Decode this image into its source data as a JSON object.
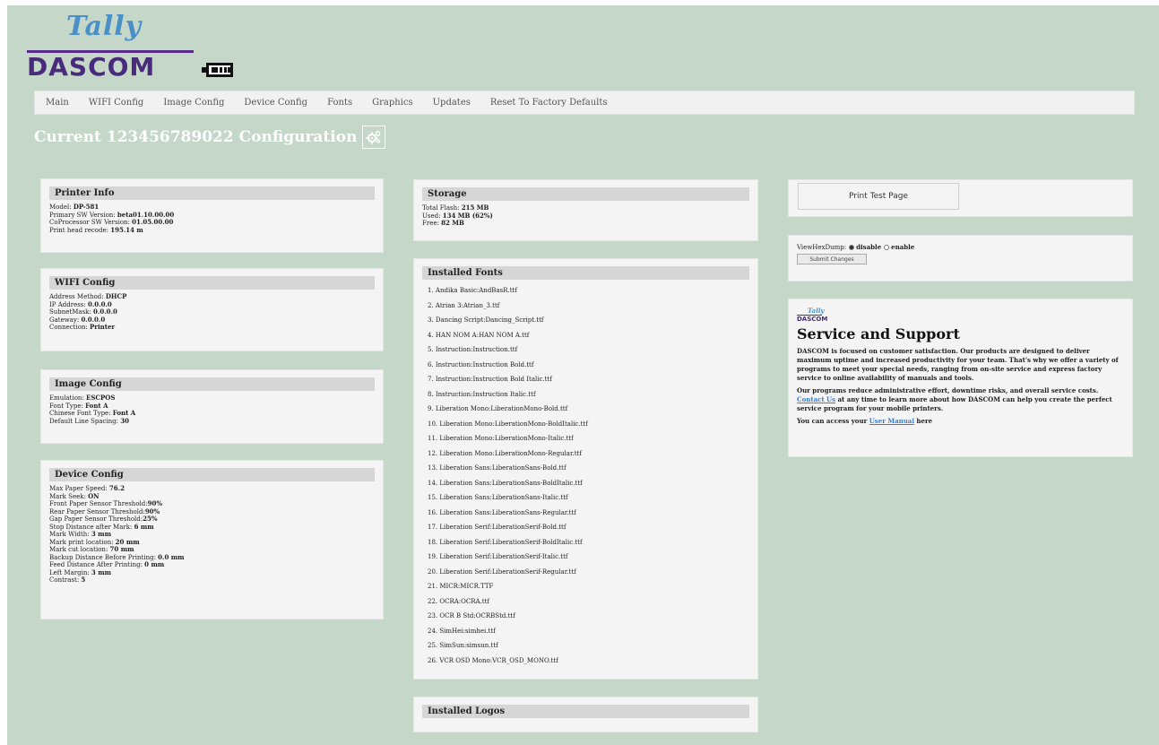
{
  "logo": {
    "tally": "Tally",
    "dascom": "DASCOM"
  },
  "nav": [
    "Main",
    "WIFI Config",
    "Image Config",
    "Device Config",
    "Fonts",
    "Graphics",
    "Updates",
    "Reset To Factory Defaults"
  ],
  "page_title": "Current 123456789022 Configuration",
  "printer_info": {
    "title": "Printer Info",
    "rows": [
      {
        "label": "Model: ",
        "value": "DP-581"
      },
      {
        "label": "Primary SW Version: ",
        "value": "beta01.10.00.00"
      },
      {
        "label": "CoProcessor SW Version: ",
        "value": "01.05.00.00"
      },
      {
        "label": "Print head recode: ",
        "value": "195.14 m"
      }
    ]
  },
  "wifi_config": {
    "title": "WIFI Config",
    "rows": [
      {
        "label": "Address Method: ",
        "value": "DHCP"
      },
      {
        "label": "IP Address: ",
        "value": "0.0.0.0"
      },
      {
        "label": "SubnetMask: ",
        "value": "0.0.0.0"
      },
      {
        "label": "Gateway: ",
        "value": "0.0.0.0"
      },
      {
        "label": "Connection: ",
        "value": "Printer"
      }
    ]
  },
  "image_config": {
    "title": "Image Config",
    "rows": [
      {
        "label": "Emulation: ",
        "value": "ESCPOS"
      },
      {
        "label": "Font Type: ",
        "value": "Font A"
      },
      {
        "label": "Chinese Font Type: ",
        "value": "Font A"
      },
      {
        "label": "Default Line Spacing: ",
        "value": "30"
      }
    ]
  },
  "device_config": {
    "title": "Device Config",
    "rows": [
      {
        "label": "Max Paper Speed: ",
        "value": "76.2"
      },
      {
        "label": "Mark Seek: ",
        "value": "ON"
      },
      {
        "label": "Front Paper Sensor Threshold:",
        "value": "90%"
      },
      {
        "label": "Rear Paper Sensor Threshold:",
        "value": "90%"
      },
      {
        "label": "Gap Paper Sensor Threshold:",
        "value": "25%"
      },
      {
        "label": "Stop Distance after Mark: ",
        "value": "6 mm"
      },
      {
        "label": "Mark Width: ",
        "value": "3 mm"
      },
      {
        "label": "Mark print location: ",
        "value": "20 mm"
      },
      {
        "label": "Mark cut location: ",
        "value": "70 mm"
      },
      {
        "label": "Backup Distance Before Printing: ",
        "value": "0.0 mm"
      },
      {
        "label": "Feed Distance After Printing: ",
        "value": "0 mm"
      },
      {
        "label": "Left Margin: ",
        "value": "3 mm"
      },
      {
        "label": "Contrast: ",
        "value": "5"
      }
    ]
  },
  "storage": {
    "title": "Storage",
    "rows": [
      {
        "label": "Total Flash: ",
        "value": "215 MB"
      },
      {
        "label": "Used: ",
        "value": "134 MB (62%)"
      },
      {
        "label": "Free: ",
        "value": "82 MB"
      }
    ]
  },
  "installed_fonts": {
    "title": "Installed Fonts",
    "items": [
      "1.  Andika Basic:AndBasR.ttf",
      "2.  Atrian 3:Atrian_3.ttf",
      "3.  Dancing Script:Dancing_Script.ttf",
      "4.  HAN NOM A:HAN NOM A.ttf",
      "5.  Instruction:Instruction.ttf",
      "6.  Instruction:Instruction Bold.ttf",
      "7.  Instruction:Instruction Bold Italic.ttf",
      "8.  Instruction:Instruction Italic.ttf",
      "9.  Liberation Mono:LiberationMono-Bold.ttf",
      "10.  Liberation Mono:LiberationMono-BoldItalic.ttf",
      "11.  Liberation Mono:LiberationMono-Italic.ttf",
      "12.  Liberation Mono:LiberationMono-Regular.ttf",
      "13.  Liberation Sans:LiberationSans-Bold.ttf",
      "14.  Liberation Sans:LiberationSans-BoldItalic.ttf",
      "15.  Liberation Sans:LiberationSans-Italic.ttf",
      "16.  Liberation Sans:LiberationSans-Regular.ttf",
      "17.  Liberation Serif:LiberationSerif-Bold.ttf",
      "18.  Liberation Serif:LiberationSerif-BoldItalic.ttf",
      "19.  Liberation Serif:LiberationSerif-Italic.ttf",
      "20.  Liberation Serif:LiberationSerif-Regular.ttf",
      "21.  MICR:MICR.TTF",
      "22.  OCRA:OCRA.ttf",
      "23.  OCR B Std:OCRBStd.ttf",
      "24.  SimHei:simhei.ttf",
      "25.  SimSun:simsun.ttf",
      "26.  VCR OSD Mono:VCR_OSD_MONO.ttf"
    ]
  },
  "installed_logos": {
    "title": "Installed Logos"
  },
  "print_test": {
    "label": "Print Test Page"
  },
  "hexdump": {
    "label": "ViewHexDump:",
    "disable": "disable",
    "enable": "enable",
    "selected": "disable",
    "submit": "Submit Changes"
  },
  "service": {
    "tally": "Tally",
    "dascom": "DASCOM",
    "title": "Service and Support",
    "p1": "DASCOM is focused on customer satisfaction. Our products are designed to deliver maximum uptime and increased productivity for your team. That's why we offer a variety of programs to meet your special needs, ranging from on-site service and express factory service to online availability of manuals and tools.",
    "p2_before": "Our programs reduce administrative effort, downtime risks, and overall service costs. ",
    "p2_link": "Contact Us",
    "p2_after": " at any time to learn more about how DASCOM can help you create the perfect service program for your mobile printers.",
    "p3_before": "You can access your ",
    "p3_link": "User Manual",
    "p3_after": " here"
  },
  "colors": {
    "background": "#c5d7c8",
    "panel": "#f4f4f4",
    "header": "#d6d6d6",
    "brand_purple": "#4a2a7c",
    "brand_blue": "#4a90c8"
  }
}
